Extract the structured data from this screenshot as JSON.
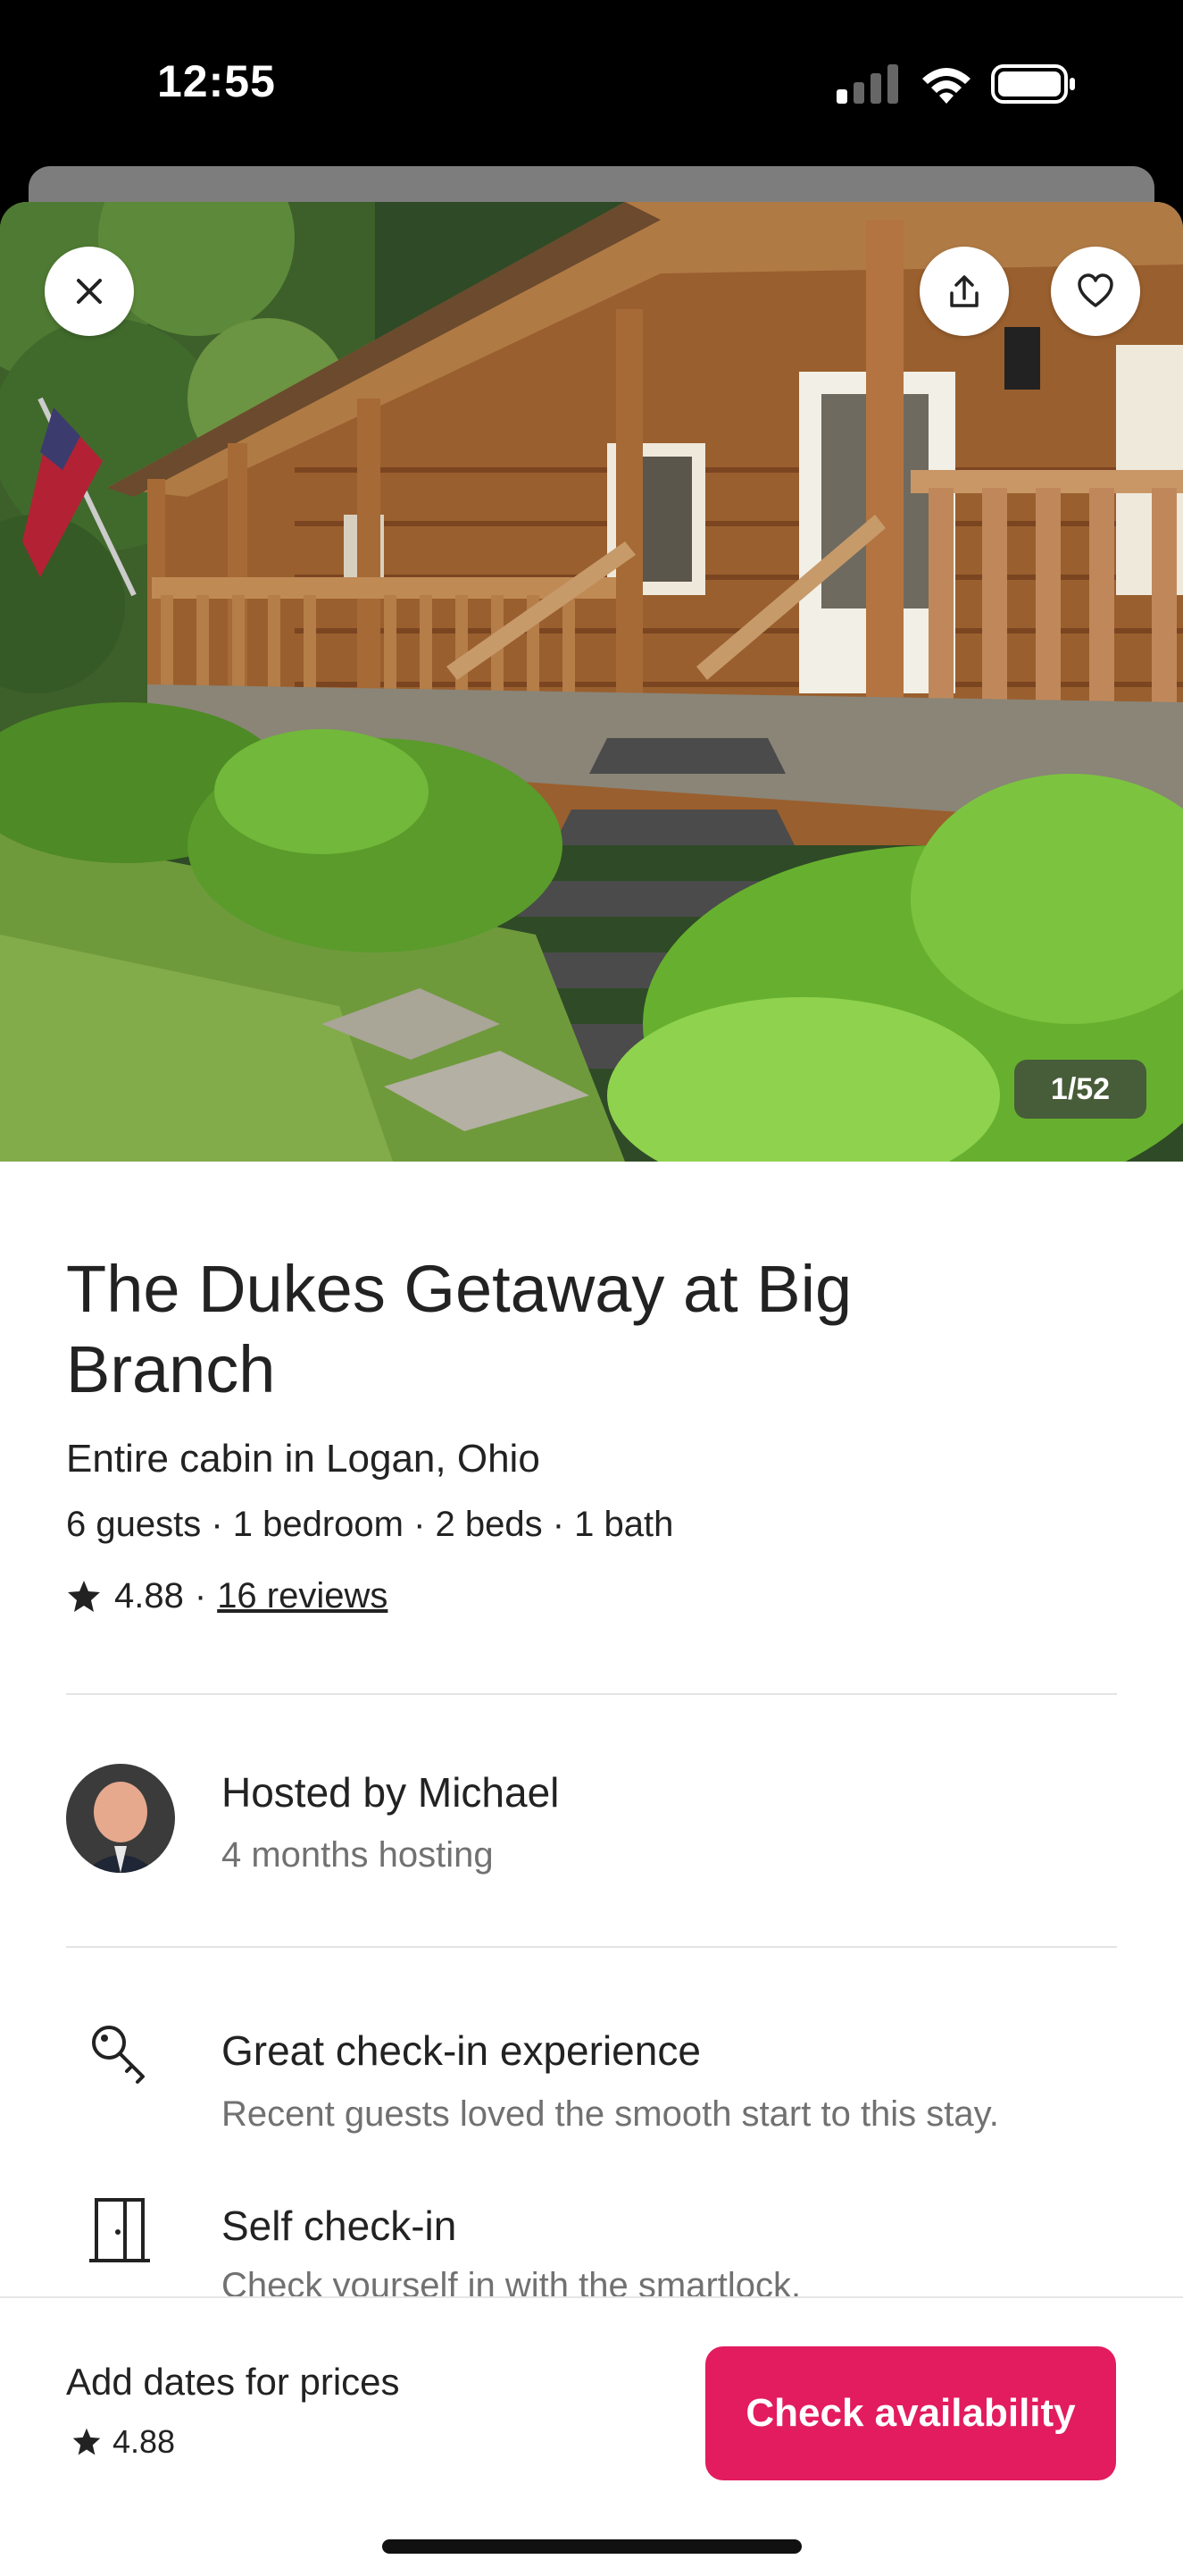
{
  "status_bar": {
    "time": "12:55"
  },
  "hero": {
    "photo_counter": "1/52"
  },
  "listing": {
    "title": "The Dukes Getaway at Big Branch",
    "subtitle": "Entire cabin in Logan, Ohio",
    "details": "6 guests · 1 bedroom · 2 beds · 1 bath",
    "rating": "4.88",
    "separator": "·",
    "reviews_link": "16 reviews"
  },
  "host": {
    "title": "Hosted by Michael",
    "subtitle": "4 months hosting"
  },
  "features": [
    {
      "title": "Great check-in experience",
      "description": "Recent guests loved the smooth start to this stay.",
      "icon": "key-icon"
    },
    {
      "title": "Self check-in",
      "description": "Check yourself in with the smartlock.",
      "icon": "door-icon"
    }
  ],
  "footer": {
    "prompt": "Add dates for prices",
    "rating": "4.88",
    "button": "Check availability"
  },
  "colors": {
    "accent": "#e31c5f",
    "text": "#222222",
    "muted": "#717171"
  }
}
